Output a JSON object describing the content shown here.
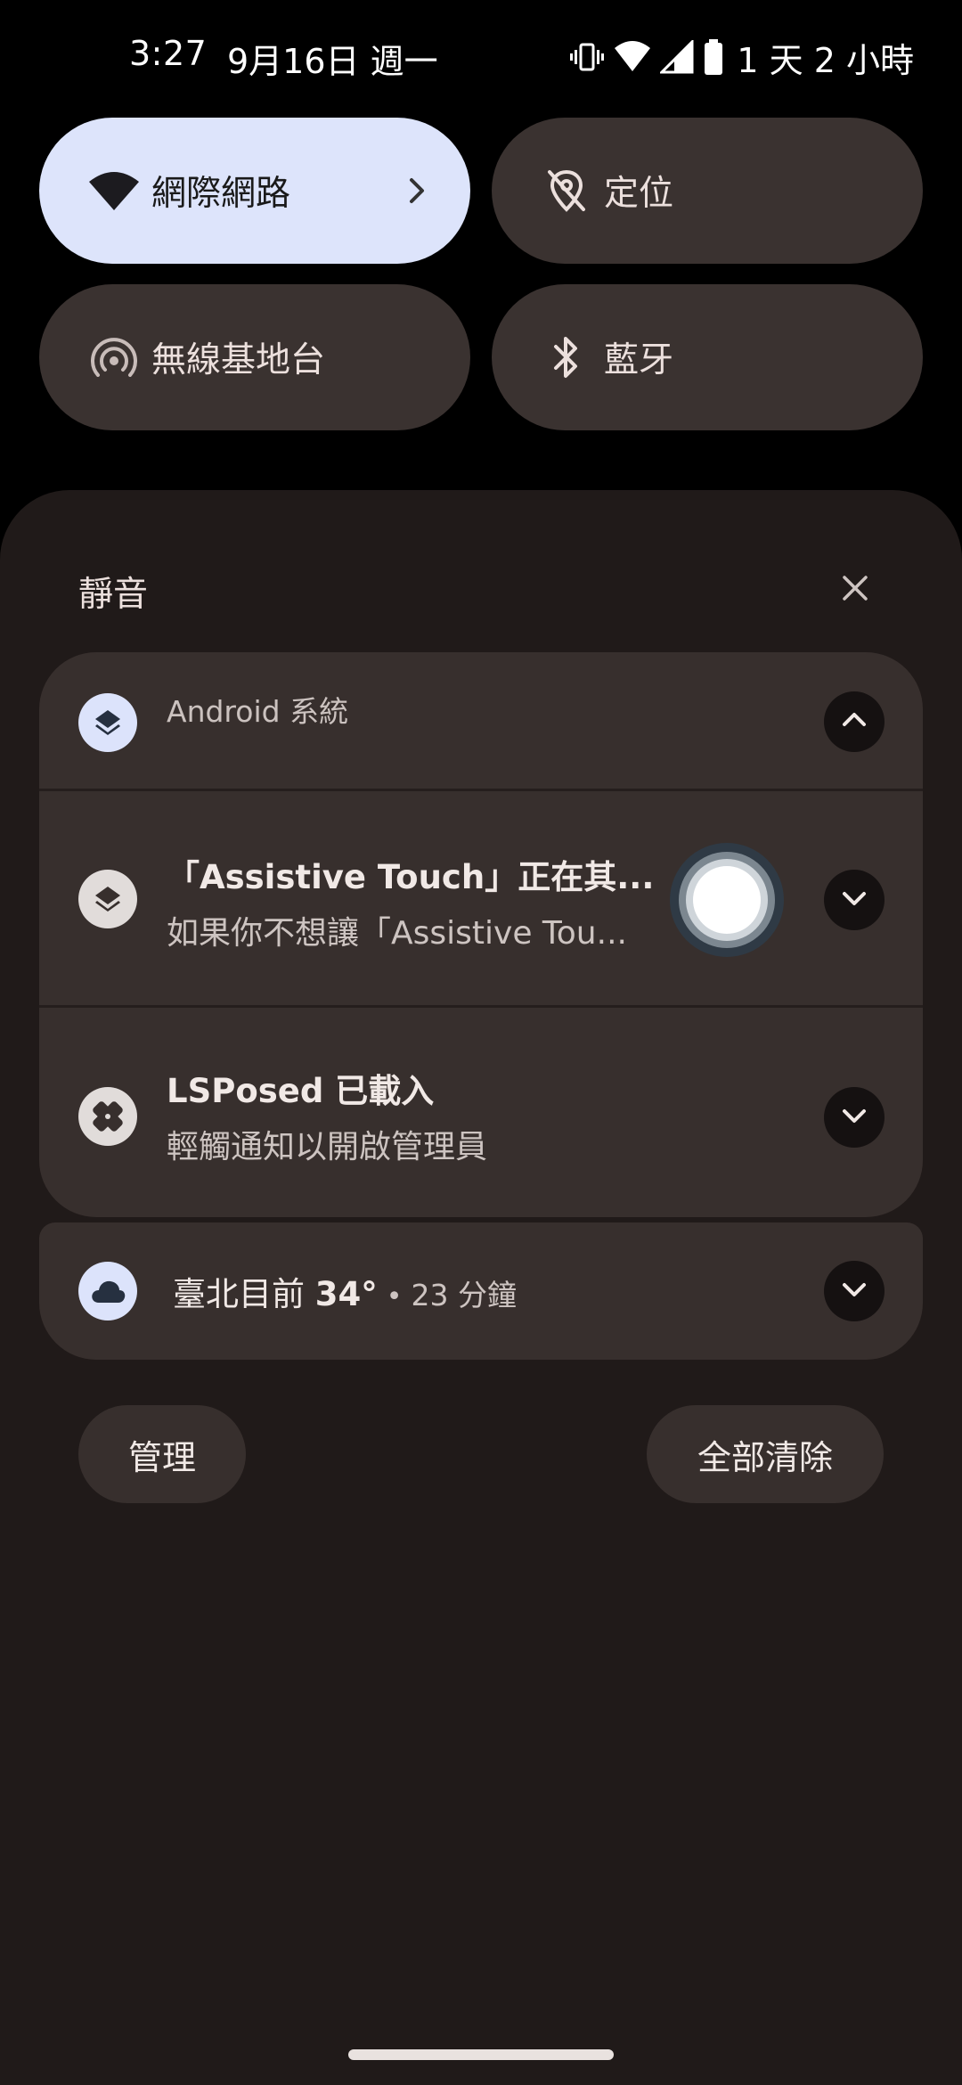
{
  "status_bar": {
    "time": "3:27",
    "date": "9月16日 週一",
    "battery_remaining": "1 天 2 小時",
    "icons": [
      "vibrate-icon",
      "wifi-icon",
      "cell-signal-icon",
      "battery-icon"
    ]
  },
  "quick_settings": {
    "tiles": [
      {
        "label": "網際網路",
        "icon": "wifi-icon",
        "active": true
      },
      {
        "label": "定位",
        "icon": "location-off-icon",
        "active": false
      },
      {
        "label": "無線基地台",
        "icon": "hotspot-icon",
        "active": false
      },
      {
        "label": "藍牙",
        "icon": "bluetooth-icon",
        "active": false
      }
    ]
  },
  "notifications": {
    "section_title": "靜音",
    "group": {
      "app_name": "Android 系統",
      "items": [
        {
          "title": "「Assistive Touch」正在其...",
          "text": "如果你不想讓「Assistive Tou..."
        },
        {
          "title": "LSPosed 已載入",
          "text": "輕觸通知以開啟管理員"
        }
      ]
    },
    "weather": {
      "title": "臺北目前 ",
      "temp": "34°",
      "separator": "•",
      "time": "23 分鐘"
    }
  },
  "actions": {
    "manage_label": "管理",
    "clear_all_label": "全部清除"
  },
  "colors": {
    "active_tile": "#dde4fb",
    "inactive_tile": "#3a3230",
    "shade_background": "#201a19",
    "card_background": "#372f2d"
  }
}
